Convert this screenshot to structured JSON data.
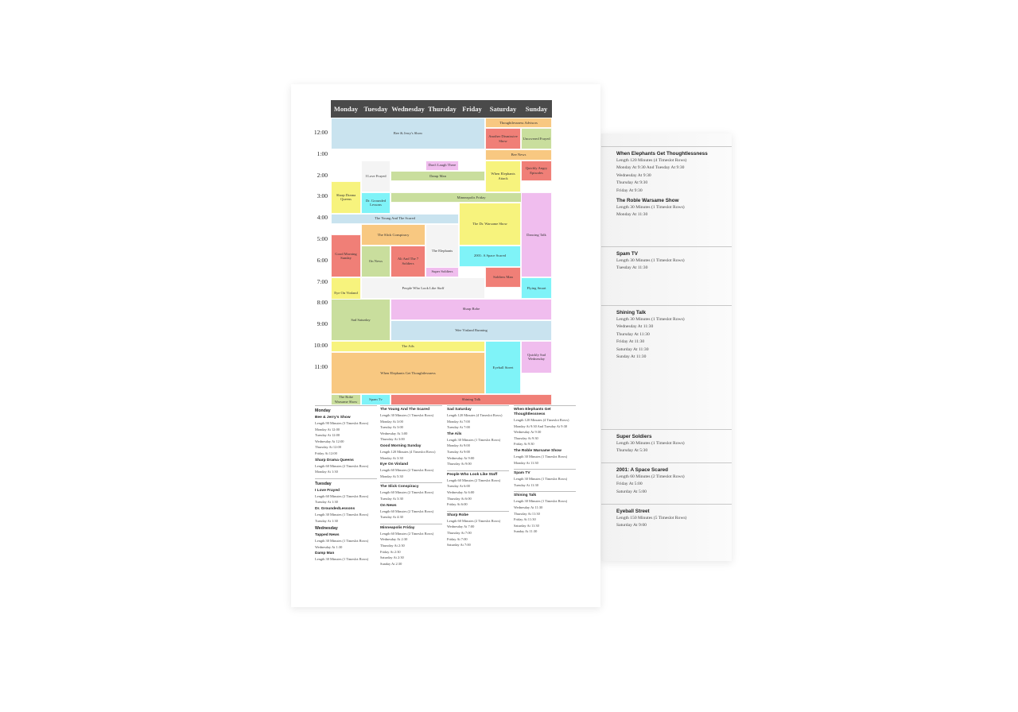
{
  "schedule": {
    "days": [
      "Monday",
      "Tuesday",
      "Wednesday",
      "Thursday",
      "Friday",
      "Saturday",
      "Sunday"
    ],
    "times": [
      "12:00",
      "1:00",
      "2:00",
      "3:00",
      "4:00",
      "5:00",
      "6:00",
      "7:00",
      "8:00",
      "9:00",
      "10:00",
      "11:00"
    ],
    "colors": {
      "blue": "#c9e3ef",
      "yellow": "#f7f37d",
      "orange": "#f8c881",
      "red": "#f07f77",
      "green": "#c9de9d",
      "pink": "#f0bdee",
      "cyan": "#7ff3f8",
      "white": "#f4f4f4",
      "header": "#4a4a4a"
    },
    "blocks": [
      {
        "title": "Thoughtlessness Advisors",
        "color": "orange"
      },
      {
        "title": "Bee & Jerry's Show",
        "color": "blue"
      },
      {
        "title": "Another Dismissive Show",
        "color": "red"
      },
      {
        "title": "Uncovered Frayed",
        "color": "green"
      },
      {
        "title": "Bee News",
        "color": "orange"
      },
      {
        "title": "Tapped News",
        "color": "cyan"
      },
      {
        "title": "Don't Laugh There",
        "color": "pink"
      },
      {
        "title": "I Love Frayed",
        "color": "white"
      },
      {
        "title": "Damp Man",
        "color": "green"
      },
      {
        "title": "When Elephants Attack",
        "color": "yellow"
      },
      {
        "title": "Quickly Angry Episodes",
        "color": "red"
      },
      {
        "title": "Sharp Drama Queens",
        "color": "yellow"
      },
      {
        "title": "Dr. Grounded Lessons",
        "color": "cyan"
      },
      {
        "title": "Minneapolis Friday",
        "color": "green"
      },
      {
        "title": "The Young And The Scared",
        "color": "blue"
      },
      {
        "title": "The Slick Conspiracy",
        "color": "orange"
      },
      {
        "title": "The Elephants",
        "color": "white"
      },
      {
        "title": "The Dr. Warsame Show",
        "color": "yellow"
      },
      {
        "title": "Dancing Talk",
        "color": "pink"
      },
      {
        "title": "Good Morning Sunday",
        "color": "red"
      },
      {
        "title": "On News",
        "color": "green"
      },
      {
        "title": "Ali And The 7 Soldiers",
        "color": "red"
      },
      {
        "title": "2001: A Space Scared",
        "color": "cyan"
      },
      {
        "title": "Super Soldiers",
        "color": "pink"
      },
      {
        "title": "Eye On Vinland",
        "color": "yellow"
      },
      {
        "title": "People Who Look Like Staff",
        "color": "white"
      },
      {
        "title": "Soldiers Man",
        "color": "red"
      },
      {
        "title": "Flying Smart",
        "color": "cyan"
      },
      {
        "title": "Sharp Robe",
        "color": "pink"
      },
      {
        "title": "Sad Saturday",
        "color": "green"
      },
      {
        "title": "Wee Vinland Running",
        "color": "blue"
      },
      {
        "title": "The Ails",
        "color": "yellow"
      },
      {
        "title": "When Elephants Get Thoughtlessness",
        "color": "orange"
      },
      {
        "title": "Eyeball Street",
        "color": "cyan"
      },
      {
        "title": "Quickly Sad Wednesday",
        "color": "pink"
      },
      {
        "title": "The Robe Warsame Show",
        "color": "green"
      },
      {
        "title": "Spam Tv",
        "color": "cyan"
      },
      {
        "title": "Shining Talk",
        "color": "red"
      }
    ]
  },
  "listing": {
    "col1": {
      "day1": "Monday",
      "s1": {
        "title": "Bee & Jerry's Show",
        "lines": [
          "Length 90 Minutes (3 Timeslot Rows)",
          "Monday At 12:00",
          "Tuesday At 12:00",
          "Wednesday At 12:00",
          "Thursday At 12:00",
          "Friday At 12:00"
        ]
      },
      "s2": {
        "title": "Sharp Drama Queens",
        "lines": [
          "Length 60 Minutes (2 Timeslot Rows)",
          "Monday At 1:30"
        ]
      },
      "day2": "Tuesday",
      "s3": {
        "title": "I Love Frayed",
        "lines": [
          "Length 60 Minutes (2 Timeslot Rows)",
          "Tuesday At 1:30"
        ]
      },
      "s4": {
        "title": "Dr. GroundedLessons",
        "lines": [
          "Length 30 Minutes (1 Timeslot Rows)",
          "Tuesday At 1:30"
        ]
      },
      "day3": "Wednesday",
      "s5": {
        "title": "Tapped News",
        "lines": [
          "Length 30 Minutes (1 Timeslot Rows)",
          "Wednesday At 1:30"
        ]
      },
      "s6": {
        "title": "Damp Man",
        "lines": [
          "Length 30 Minutes (1 Timeslot Rows)"
        ]
      }
    },
    "col2": {
      "s1": {
        "title": "The Young And The Scared",
        "lines": [
          "Length 30 Minutes (1 Timeslot Rows)",
          "Monday At 3:00",
          "Tuesday At 3:00",
          "Wednesday At 3:00",
          "Thursday At 3:00"
        ]
      },
      "s2": {
        "title": "Good Morning Sunday",
        "lines": [
          "Length 120 Minutes (4 Timeslot Rows)",
          "Monday At 3:30"
        ]
      },
      "s3": {
        "title": "Eye On Vinland",
        "lines": [
          "Length 60 Minutes (2 Timeslot Rows)",
          "Monday At 5:30"
        ]
      },
      "s4": {
        "title": "The Slick Conspiracy",
        "lines": [
          "Length 60 Minutes (2 Timeslot Rows)",
          "Tuesday At 3:30"
        ]
      },
      "s5": {
        "title": "On News",
        "lines": [
          "Length 60 Minutes (2 Timeslot Rows)",
          "Tuesday At 4:30"
        ]
      },
      "s6": {
        "title": "Minneapolis Friday",
        "lines": [
          "Length 60 Minutes (2 Timeslot Rows)",
          "Wednesday At 2:30",
          "Thursday At 2:30",
          "Friday At 2:30",
          "Saturday At 2:30",
          "Sunday At 2:30"
        ]
      }
    },
    "col3": {
      "s1": {
        "title": "Sad Saturday",
        "lines": [
          "Length 120 Minutes (4 Timeslot Rows)",
          "Monday At 7:00",
          "Tuesday At 7:00"
        ]
      },
      "s2": {
        "title": "The Ails",
        "lines": [
          "Length 30 Minutes (1 Timeslot Rows)",
          "Monday At 9:00",
          "Tuesday At 9:00",
          "Wednesday At 9:00",
          "Thursday At 9:00"
        ]
      },
      "s3": {
        "title": "People Who Look Like Staff",
        "lines": [
          "Length 60 Minutes (2 Timeslot Rows)",
          "Tuesday At 6:00",
          "Wednesday At 6:00",
          "Thursday At 6:00",
          "Friday At 6:00"
        ]
      },
      "s4": {
        "title": "Sharp Robe",
        "lines": [
          "Length 60 Minutes (2 Timeslot Rows)",
          "Wednesday At 7:00",
          "Thursday At 7:00",
          "Friday At 7:00",
          "Saturday At 7:00"
        ]
      }
    },
    "col4": {
      "s1": {
        "title": "When Elephants Get Thoughtlessness",
        "lines": [
          "Length 120 Minutes (4 Timeslot Rows)",
          "Monday At 9:30 And Tuesday At 9:30",
          "Wednesday At 9:30",
          "Thursday At 9:30",
          "Friday At 9:30"
        ]
      },
      "s2": {
        "title": "The Roble Warsame Show",
        "lines": [
          "Length 30 Minutes (1 Timeslot Rows)",
          "Monday At 11:30"
        ]
      },
      "s3": {
        "title": "Spam TV",
        "lines": [
          "Length 30 Minutes (1 Timeslot Rows)",
          "Tuesday At 11:30"
        ]
      },
      "s4": {
        "title": "Shining Talk",
        "lines": [
          "Length 30 Minutes (1 Timeslot Rows)",
          "Wednesday At 11:30",
          "Thursday At 11:30",
          "Friday At 11:30",
          "Saturday At 11:30",
          "Sunday At 11:30"
        ]
      }
    }
  },
  "backpage": {
    "s1": {
      "title": "When Elephants Get Thoughtlessness",
      "lines": [
        "Length 120 Minutes (4 Timeslot Rows)",
        "Monday At 9:30 And Tuesday At 9:30",
        "Wednesday At 9:30",
        "Thursday At 9:30",
        "Friday At 9:30"
      ]
    },
    "s2": {
      "title": "The Roble Warsame Show",
      "lines": [
        "Length 30 Minutes (1 Timeslot Rows)",
        "Monday At 11:30"
      ]
    },
    "s3": {
      "title": "Spam TV",
      "lines": [
        "Length 30 Minutes (1 Timeslot Rows)",
        "Tuesday At 11:30"
      ]
    },
    "s4": {
      "title": "Shining Talk",
      "lines": [
        "Length 30 Minutes (1 Timeslot Rows)",
        "Wednesday At 11:30",
        "Thursday At 11:30",
        "Friday At 11:30",
        "Saturday At 11:30",
        "Sunday At 11:30"
      ]
    },
    "s5": {
      "title": "Super Soldiers",
      "lines": [
        "Length 30 Minutes (1 Timeslot Rows)",
        "Thursday At 5:30"
      ]
    },
    "s6": {
      "title": "2001: A Space Scared",
      "lines": [
        "Length 60 Minutes (2 Timeslot Rows)",
        "Friday At 5:00",
        "Saturday At 5:00"
      ]
    },
    "s7": {
      "title": "Eyeball Street",
      "lines": [
        "Length 150 Minutes (5 Timeslot Rows)",
        "Saturday At 9:00"
      ]
    }
  }
}
